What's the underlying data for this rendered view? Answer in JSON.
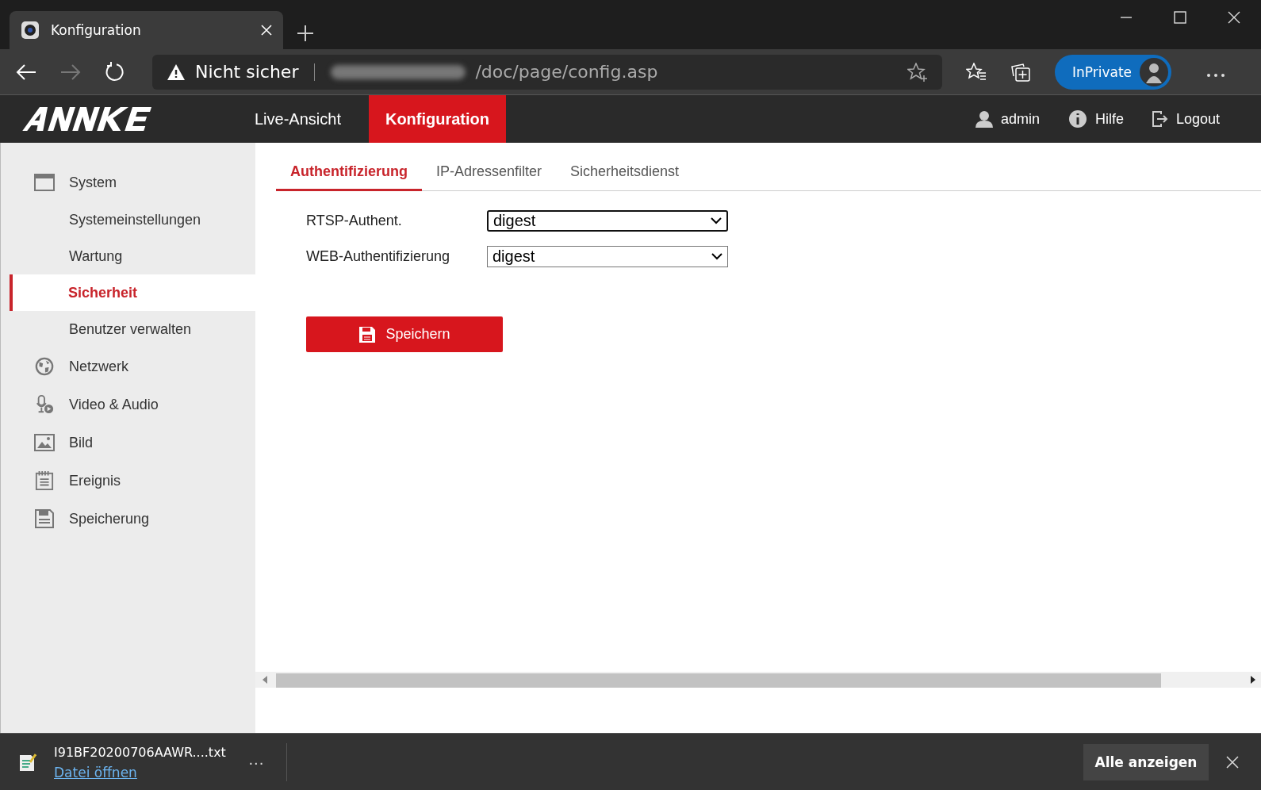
{
  "browser": {
    "tab_title": "Konfiguration",
    "address": {
      "warning": "Nicht sicher",
      "path": "/doc/page/config.asp"
    },
    "inprivate": "InPrivate"
  },
  "header": {
    "nav": [
      {
        "label": "Live-Ansicht",
        "selected": false
      },
      {
        "label": "Konfiguration",
        "selected": true
      }
    ],
    "user": "admin",
    "help": "Hilfe",
    "logout": "Logout"
  },
  "sidebar": {
    "items": [
      {
        "label": "System",
        "selected": false,
        "children": [
          {
            "label": "Systemeinstellungen",
            "selected": false
          },
          {
            "label": "Wartung",
            "selected": false
          },
          {
            "label": "Sicherheit",
            "selected": true
          },
          {
            "label": "Benutzer verwalten",
            "selected": false
          }
        ]
      },
      {
        "label": "Netzwerk",
        "selected": false
      },
      {
        "label": "Video & Audio",
        "selected": false
      },
      {
        "label": "Bild",
        "selected": false
      },
      {
        "label": "Ereignis",
        "selected": false
      },
      {
        "label": "Speicherung",
        "selected": false
      }
    ]
  },
  "tabs": [
    {
      "label": "Authentifizierung",
      "selected": true
    },
    {
      "label": "IP-Adressenfilter",
      "selected": false
    },
    {
      "label": "Sicherheitsdienst",
      "selected": false
    }
  ],
  "form": [
    {
      "label": "RTSP-Authent.",
      "value": "digest",
      "focused": true
    },
    {
      "label": "WEB-Authentifizierung",
      "value": "digest",
      "focused": false
    }
  ],
  "save_button": "Speichern",
  "download_bar": {
    "file": "I91BF20200706AAWR....txt",
    "open_link": "Datei öffnen",
    "more": "···",
    "show_all": "Alle anzeigen"
  }
}
